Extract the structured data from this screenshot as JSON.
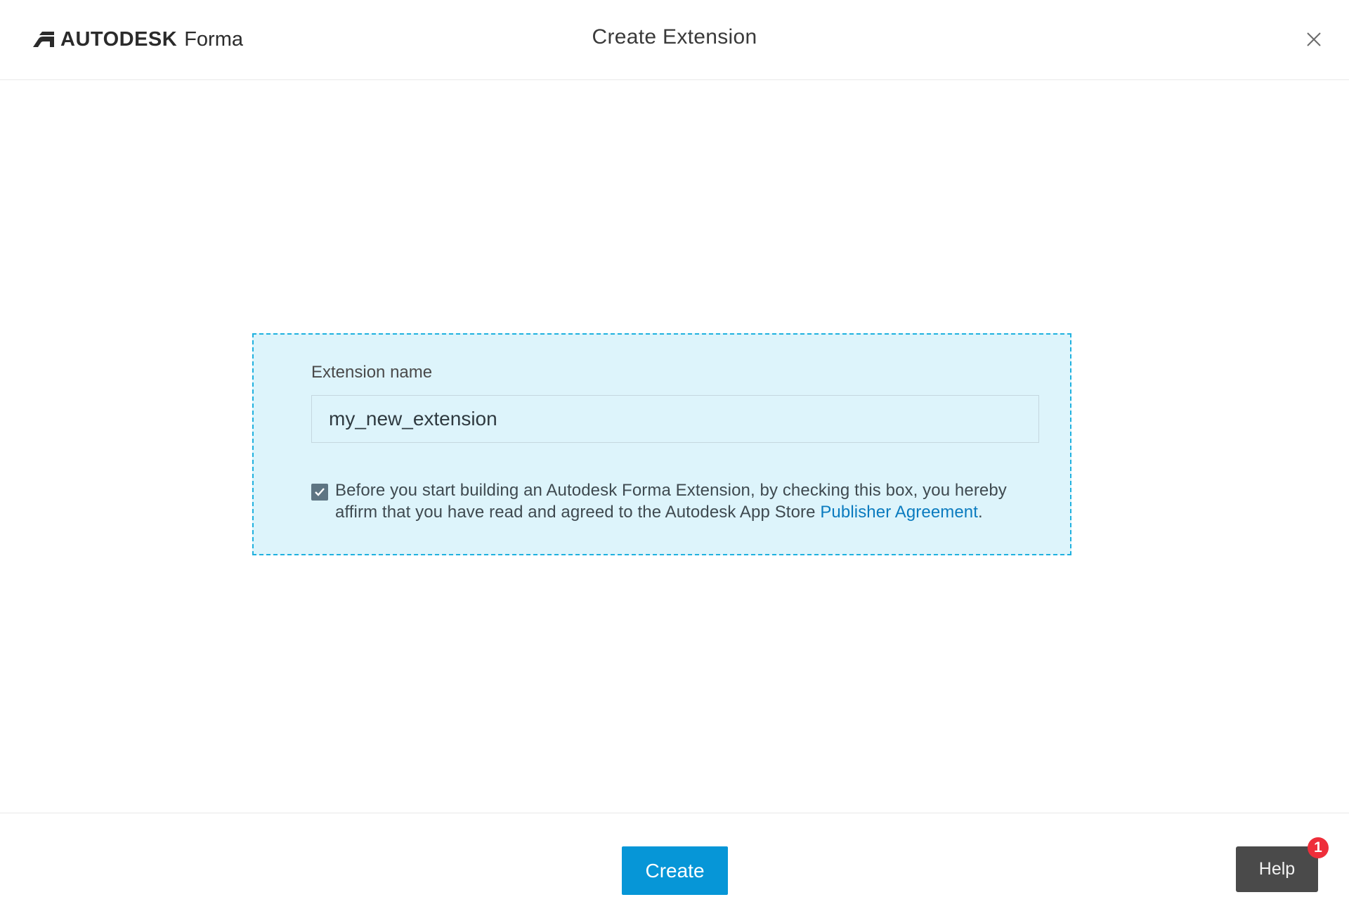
{
  "header": {
    "brand_name": "AUTODESK",
    "product_name": "Forma",
    "title": "Create Extension",
    "close_icon": "close-icon"
  },
  "form": {
    "field_label": "Extension name",
    "extension_name_value": "my_new_extension",
    "agreement_checked": true,
    "agreement_text": "Before you start building an Autodesk Forma Extension, by checking this box, you hereby affirm that you have read and agreed to the Autodesk App Store ",
    "agreement_link": "Publisher Agreement",
    "agreement_suffix": "."
  },
  "footer": {
    "create_label": "Create",
    "help_label": "Help",
    "help_badge_count": "1"
  },
  "colors": {
    "accent": "#0696d7",
    "card_background": "#ddf4fb",
    "card_border": "#1fb1df",
    "link": "#0a7bbf",
    "badge": "#ee2e3a",
    "help_button": "#4a4a4a"
  }
}
